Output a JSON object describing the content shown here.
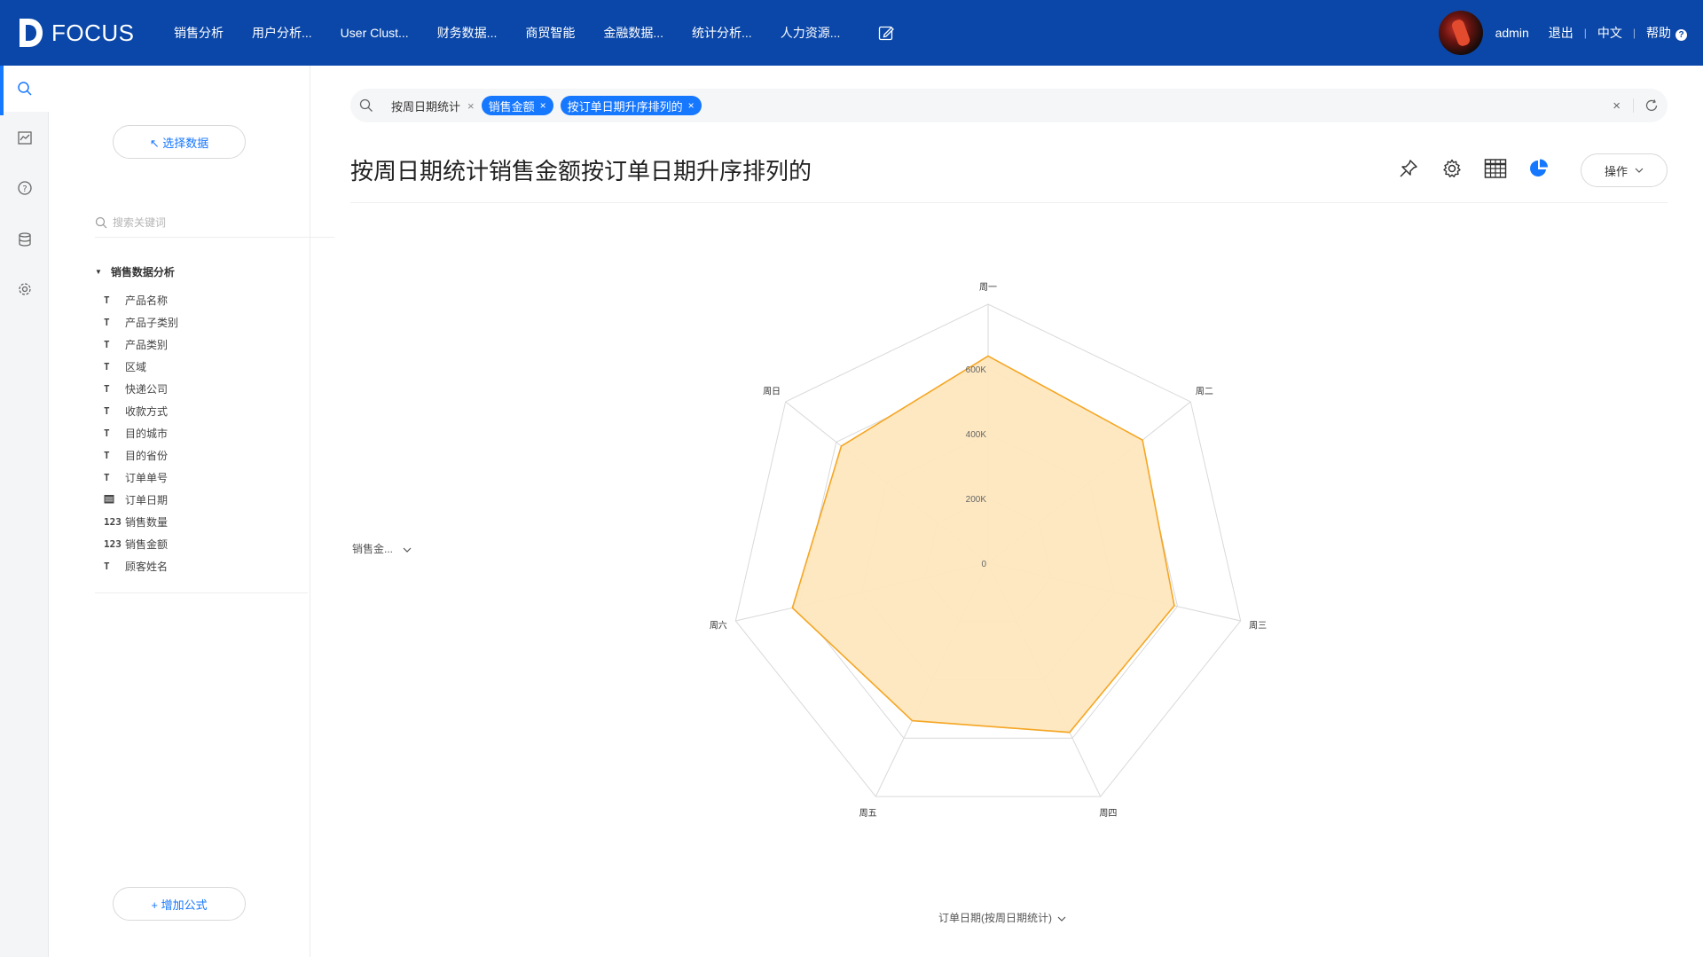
{
  "app": {
    "logo_text": "FOCUS",
    "nav": [
      "销售分析",
      "用户分析...",
      "User Clust...",
      "财务数据...",
      "商贸智能",
      "金融数据...",
      "统计分析...",
      "人力资源..."
    ],
    "user": "admin",
    "logout": "退出",
    "language": "中文",
    "help": "帮助"
  },
  "sidebar": {
    "rail_icons": [
      "search-icon",
      "board-icon",
      "help-icon",
      "database-icon",
      "settings-icon"
    ],
    "select_data_label": "↖ 选择数据",
    "search_placeholder": "搜索关键词",
    "tree_root": "销售数据分析",
    "fields": [
      {
        "icon": "T",
        "label": "产品名称"
      },
      {
        "icon": "T",
        "label": "产品子类别"
      },
      {
        "icon": "T",
        "label": "产品类别"
      },
      {
        "icon": "T",
        "label": "区域"
      },
      {
        "icon": "T",
        "label": "快递公司"
      },
      {
        "icon": "T",
        "label": "收款方式"
      },
      {
        "icon": "T",
        "label": "目的城市"
      },
      {
        "icon": "T",
        "label": "目的省份"
      },
      {
        "icon": "T",
        "label": "订单单号"
      },
      {
        "icon": "cal",
        "label": "订单日期"
      },
      {
        "icon": "123",
        "label": "销售数量"
      },
      {
        "icon": "123",
        "label": "销售金额"
      },
      {
        "icon": "T",
        "label": "顾客姓名"
      }
    ],
    "add_formula_label": "+ 增加公式"
  },
  "search": {
    "plain_token": "按周日期统计",
    "chips": [
      "销售金额",
      "按订单日期升序排列的"
    ],
    "clear_symbol": "×"
  },
  "main": {
    "title": "按周日期统计销售金额按订单日期升序排列的",
    "op_label": "操作",
    "y_selector": "销售金...",
    "x_selector": "订单日期(按周日期统计)"
  },
  "chart_data": {
    "type": "radar",
    "categories": [
      "周一",
      "周二",
      "周三",
      "周四",
      "周五",
      "周六",
      "周日"
    ],
    "series": [
      {
        "values": [
          640000,
          610000,
          590000,
          580000,
          540000,
          620000,
          580000
        ],
        "color": "#f5a623"
      }
    ],
    "rmax": 800000,
    "ticks": [
      0,
      200000,
      400000,
      600000
    ],
    "tick_labels": [
      "0",
      "200K",
      "400K",
      "600K"
    ]
  },
  "colors": {
    "topbar": "#0a47a9",
    "accent": "#1677ff",
    "radar_fill": "#fde7bf",
    "radar_stroke": "#f5a623"
  }
}
